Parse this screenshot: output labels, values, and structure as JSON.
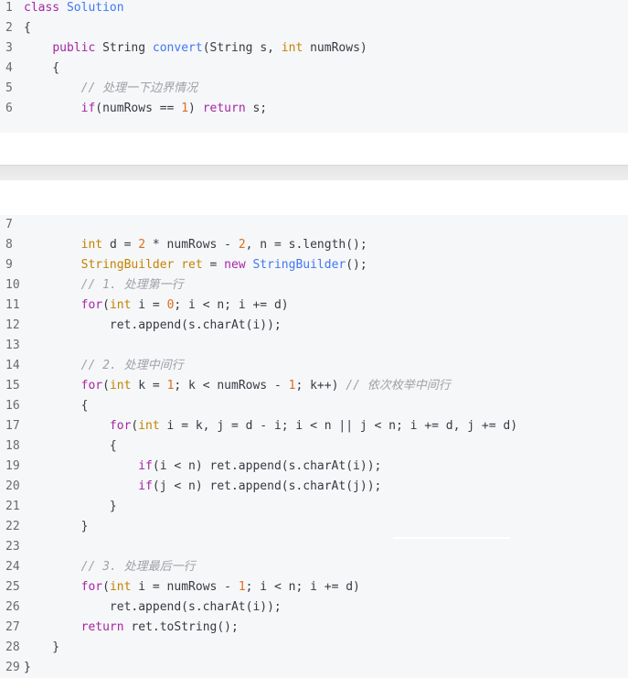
{
  "block1": {
    "lines": [
      {
        "num": "1",
        "segments": [
          [
            "kw",
            "class "
          ],
          [
            "cls",
            "Solution"
          ]
        ]
      },
      {
        "num": "2",
        "segments": [
          [
            "op",
            "{"
          ]
        ]
      },
      {
        "num": "3",
        "segments": [
          [
            "op",
            "    "
          ],
          [
            "kw",
            "public "
          ],
          [
            "op",
            "String "
          ],
          [
            "fn",
            "convert"
          ],
          [
            "op",
            "(String s, "
          ],
          [
            "type",
            "int "
          ],
          [
            "op",
            "numRows)"
          ]
        ]
      },
      {
        "num": "4",
        "segments": [
          [
            "op",
            "    {"
          ]
        ]
      },
      {
        "num": "5",
        "segments": [
          [
            "op",
            "        "
          ],
          [
            "com",
            "// 处理一下边界情况"
          ]
        ]
      },
      {
        "num": "6",
        "segments": [
          [
            "op",
            "        "
          ],
          [
            "kw",
            "if"
          ],
          [
            "op",
            "(numRows == "
          ],
          [
            "num",
            "1"
          ],
          [
            "op",
            ") "
          ],
          [
            "kw",
            "return "
          ],
          [
            "op",
            "s;"
          ]
        ]
      }
    ]
  },
  "block2": {
    "lines": [
      {
        "num": "7",
        "segments": []
      },
      {
        "num": "8",
        "segments": [
          [
            "op",
            "        "
          ],
          [
            "type",
            "int "
          ],
          [
            "op",
            "d = "
          ],
          [
            "num",
            "2"
          ],
          [
            "op",
            " * numRows - "
          ],
          [
            "num",
            "2"
          ],
          [
            "op",
            ", n = s.length();"
          ]
        ]
      },
      {
        "num": "9",
        "segments": [
          [
            "op",
            "        "
          ],
          [
            "type",
            "StringBuilder "
          ],
          [
            "type",
            "ret "
          ],
          [
            "op",
            "= "
          ],
          [
            "kw",
            "new "
          ],
          [
            "cls",
            "StringBuilder"
          ],
          [
            "op",
            "();"
          ]
        ]
      },
      {
        "num": "10",
        "segments": [
          [
            "op",
            "        "
          ],
          [
            "com",
            "// 1. 处理第一行"
          ]
        ]
      },
      {
        "num": "11",
        "segments": [
          [
            "op",
            "        "
          ],
          [
            "kw",
            "for"
          ],
          [
            "op",
            "("
          ],
          [
            "type",
            "int "
          ],
          [
            "op",
            "i = "
          ],
          [
            "num",
            "0"
          ],
          [
            "op",
            "; i < n; i += d)"
          ]
        ]
      },
      {
        "num": "12",
        "segments": [
          [
            "op",
            "            ret.append(s.charAt(i));"
          ]
        ]
      },
      {
        "num": "13",
        "segments": []
      },
      {
        "num": "14",
        "segments": [
          [
            "op",
            "        "
          ],
          [
            "com",
            "// 2. 处理中间行"
          ]
        ]
      },
      {
        "num": "15",
        "segments": [
          [
            "op",
            "        "
          ],
          [
            "kw",
            "for"
          ],
          [
            "op",
            "("
          ],
          [
            "type",
            "int "
          ],
          [
            "op",
            "k = "
          ],
          [
            "num",
            "1"
          ],
          [
            "op",
            "; k < numRows - "
          ],
          [
            "num",
            "1"
          ],
          [
            "op",
            "; k++) "
          ],
          [
            "com",
            "// 依次枚举中间行"
          ]
        ]
      },
      {
        "num": "16",
        "segments": [
          [
            "op",
            "        {"
          ]
        ]
      },
      {
        "num": "17",
        "segments": [
          [
            "op",
            "            "
          ],
          [
            "kw",
            "for"
          ],
          [
            "op",
            "("
          ],
          [
            "type",
            "int "
          ],
          [
            "op",
            "i = k, j = d - i; i < n || j < n; i += d, j += d)"
          ]
        ]
      },
      {
        "num": "18",
        "segments": [
          [
            "op",
            "            {"
          ]
        ]
      },
      {
        "num": "19",
        "segments": [
          [
            "op",
            "                "
          ],
          [
            "kw",
            "if"
          ],
          [
            "op",
            "(i < n) ret.append(s.charAt(i));"
          ]
        ]
      },
      {
        "num": "20",
        "segments": [
          [
            "op",
            "                "
          ],
          [
            "kw",
            "if"
          ],
          [
            "op",
            "(j < n) ret.append(s.charAt(j));"
          ]
        ]
      },
      {
        "num": "21",
        "segments": [
          [
            "op",
            "            }"
          ]
        ]
      },
      {
        "num": "22",
        "segments": [
          [
            "op",
            "        }"
          ]
        ]
      },
      {
        "num": "23",
        "segments": []
      },
      {
        "num": "24",
        "segments": [
          [
            "op",
            "        "
          ],
          [
            "com",
            "// 3. 处理最后一行"
          ]
        ]
      },
      {
        "num": "25",
        "segments": [
          [
            "op",
            "        "
          ],
          [
            "kw",
            "for"
          ],
          [
            "op",
            "("
          ],
          [
            "type",
            "int "
          ],
          [
            "op",
            "i = numRows - "
          ],
          [
            "num",
            "1"
          ],
          [
            "op",
            "; i < n; i += d)"
          ]
        ]
      },
      {
        "num": "26",
        "segments": [
          [
            "op",
            "            ret.append(s.charAt(i));"
          ]
        ]
      },
      {
        "num": "27",
        "segments": [
          [
            "op",
            "        "
          ],
          [
            "kw",
            "return "
          ],
          [
            "op",
            "ret.toString();"
          ]
        ]
      },
      {
        "num": "28",
        "segments": [
          [
            "op",
            "    }"
          ]
        ]
      },
      {
        "num": "29",
        "segments": [
          [
            "op",
            "}"
          ]
        ]
      }
    ]
  }
}
